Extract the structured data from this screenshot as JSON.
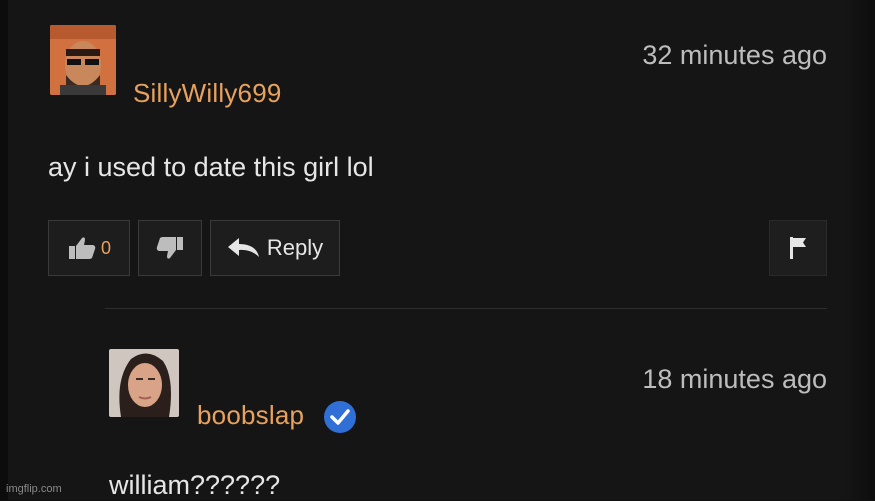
{
  "comments": [
    {
      "username": "SillyWilly699",
      "time": "32 minutes ago",
      "text": "ay i used to date this girl lol",
      "like_count": "0",
      "reply_label": "Reply"
    },
    {
      "username": "boobslap",
      "time": "18 minutes ago",
      "text": "william??????",
      "verified": true
    }
  ],
  "watermark": "imgflip.com",
  "colors": {
    "background": "#151515",
    "username": "#e8a15e",
    "verified_badge": "#2f6fd6"
  }
}
